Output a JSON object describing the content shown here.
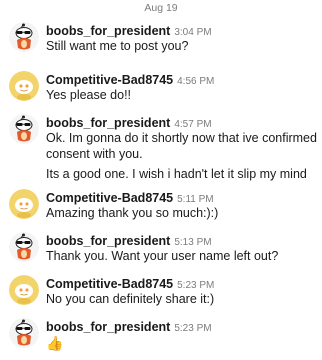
{
  "date_label": "Aug 19",
  "messages": [
    {
      "user": "boobs_for_president",
      "time": "3:04 PM",
      "lines": [
        "Still want me to post you?"
      ]
    },
    {
      "user": "Competitive-Bad8745",
      "time": "4:56 PM",
      "lines": [
        "Yes please do!!"
      ]
    },
    {
      "user": "boobs_for_president",
      "time": "4:57 PM",
      "lines": [
        "Ok.  Im gonna do it shortly now that ive confirmed consent with you.",
        "Its a good one. I wish i hadn't let it slip my mind"
      ]
    },
    {
      "user": "Competitive-Bad8745",
      "time": "5:11 PM",
      "lines": [
        "Amazing thank you so much:):)"
      ]
    },
    {
      "user": "boobs_for_president",
      "time": "5:13 PM",
      "lines": [
        "Thank you.  Want your user name left out?"
      ]
    },
    {
      "user": "Competitive-Bad8745",
      "time": "5:23 PM",
      "lines": [
        "No you can definitely share it:)"
      ]
    },
    {
      "user": "boobs_for_president",
      "time": "5:23 PM",
      "lines": [
        "👍"
      ]
    }
  ],
  "colors": {
    "snoo_avatar_bg": "#f4f4f4",
    "default_avatar_bg": "#f2d46a",
    "muted_text": "#7c7c7c"
  },
  "icons": {
    "user_a_avatar": "snoo-sunglasses-avatar-icon",
    "user_b_avatar": "default-yellow-avatar-icon"
  }
}
